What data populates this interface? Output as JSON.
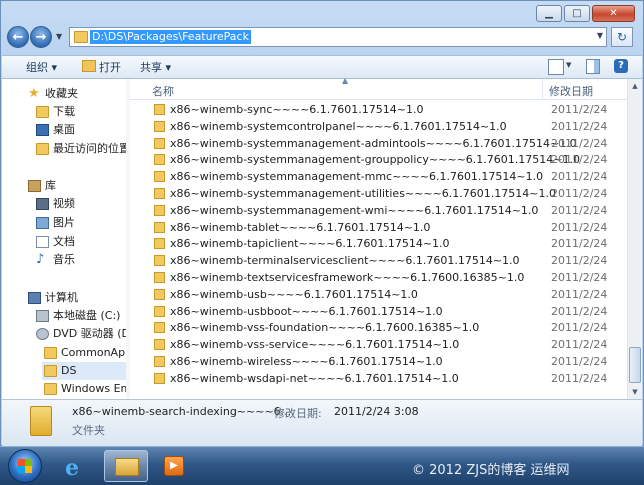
{
  "window": {
    "address": "D:\\DS\\Packages\\FeaturePack",
    "caption_minimize": "▁",
    "caption_maximize": "□",
    "caption_close": "✕"
  },
  "toolbar": {
    "organize": "组织 ▾",
    "open": "打开",
    "share": "共享 ▾"
  },
  "navpane": {
    "favorites": "收藏夹",
    "downloads": "下载",
    "desktop": "桌面",
    "recent": "最近访问的位置",
    "libraries": "库",
    "videos": "视频",
    "pictures": "图片",
    "documents": "文档",
    "music": "音乐",
    "computer": "计算机",
    "local_disk": "本地磁盘 (C:)",
    "dvd_drive": "DVD 驱动器 (D:)",
    "folder_common": "CommonAppl",
    "folder_ds": "DS",
    "folder_windows": "Windows Emb"
  },
  "columns": {
    "name": "名称",
    "date": "修改日期"
  },
  "files": [
    {
      "name": "x86~winemb-sync~~~~6.1.7601.17514~1.0",
      "date": "2011/2/24"
    },
    {
      "name": "x86~winemb-systemcontrolpanel~~~~6.1.7601.17514~1.0",
      "date": "2011/2/24"
    },
    {
      "name": "x86~winemb-systemmanagement-admintools~~~~6.1.7601.17514~1.0",
      "date": "2011/2/24"
    },
    {
      "name": "x86~winemb-systemmanagement-grouppolicy~~~~6.1.7601.17514~1.0",
      "date": "2011/2/24"
    },
    {
      "name": "x86~winemb-systemmanagement-mmc~~~~6.1.7601.17514~1.0",
      "date": "2011/2/24"
    },
    {
      "name": "x86~winemb-systemmanagement-utilities~~~~6.1.7601.17514~1.0",
      "date": "2011/2/24"
    },
    {
      "name": "x86~winemb-systemmanagement-wmi~~~~6.1.7601.17514~1.0",
      "date": "2011/2/24"
    },
    {
      "name": "x86~winemb-tablet~~~~6.1.7601.17514~1.0",
      "date": "2011/2/24"
    },
    {
      "name": "x86~winemb-tapiclient~~~~6.1.7601.17514~1.0",
      "date": "2011/2/24"
    },
    {
      "name": "x86~winemb-terminalservicesclient~~~~6.1.7601.17514~1.0",
      "date": "2011/2/24"
    },
    {
      "name": "x86~winemb-textservicesframework~~~~6.1.7600.16385~1.0",
      "date": "2011/2/24"
    },
    {
      "name": "x86~winemb-usb~~~~6.1.7601.17514~1.0",
      "date": "2011/2/24"
    },
    {
      "name": "x86~winemb-usbboot~~~~6.1.7601.17514~1.0",
      "date": "2011/2/24"
    },
    {
      "name": "x86~winemb-vss-foundation~~~~6.1.7600.16385~1.0",
      "date": "2011/2/24"
    },
    {
      "name": "x86~winemb-vss-service~~~~6.1.7601.17514~1.0",
      "date": "2011/2/24"
    },
    {
      "name": "x86~winemb-wireless~~~~6.1.7601.17514~1.0",
      "date": "2011/2/24"
    },
    {
      "name": "x86~winemb-wsdapi-net~~~~6.1.7601.17514~1.0",
      "date": "2011/2/24"
    }
  ],
  "details": {
    "name": "x86~winemb-search-indexing~~~~6....",
    "date_label": "修改日期:",
    "date": "2011/2/24 3:08",
    "type": "文件夹"
  },
  "taskbar": {
    "watermark": "© 2012 ZJS的博客 运维网"
  },
  "icons": {
    "favorites": "star-icon",
    "folder": "folder-icon",
    "back": "back-arrow-icon",
    "forward": "forward-arrow-icon",
    "refresh": "refresh-icon",
    "help": "help-icon"
  }
}
